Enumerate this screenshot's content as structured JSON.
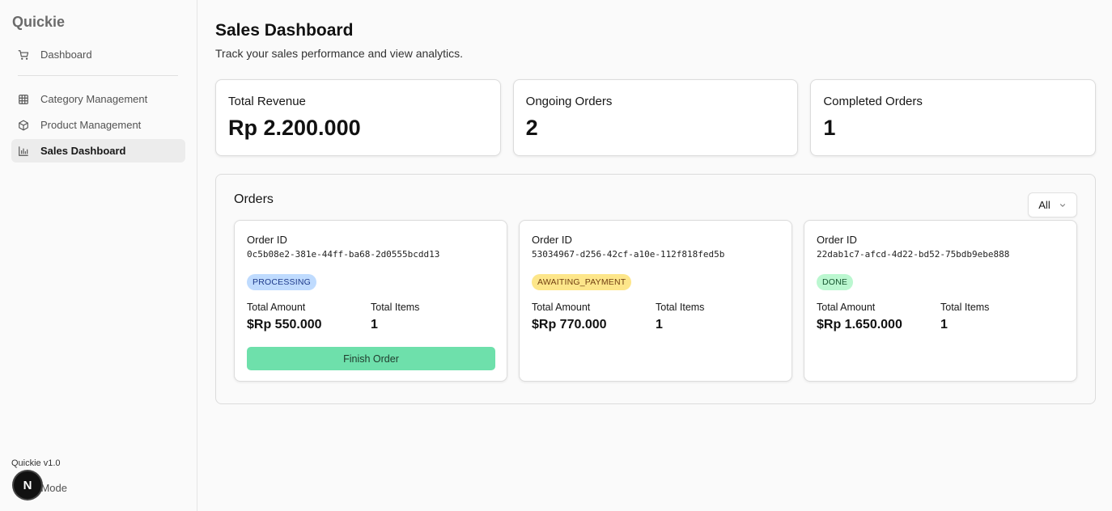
{
  "brand": "Quickie",
  "sidebar": {
    "items": [
      {
        "label": "Dashboard",
        "icon": "cart-icon"
      },
      {
        "label": "Category Management",
        "icon": "grid-icon"
      },
      {
        "label": "Product Management",
        "icon": "box-icon"
      },
      {
        "label": "Sales Dashboard",
        "icon": "bar-chart-icon",
        "active": true
      }
    ],
    "version": "Quickie v1.0",
    "theme_mode": "nt Mode",
    "next_badge": "N"
  },
  "header": {
    "title": "Sales Dashboard",
    "subtitle": "Track your sales performance and view analytics."
  },
  "stats": [
    {
      "label": "Total Revenue",
      "value": "Rp 2.200.000"
    },
    {
      "label": "Ongoing Orders",
      "value": "2"
    },
    {
      "label": "Completed Orders",
      "value": "1"
    }
  ],
  "orders": {
    "title": "Orders",
    "filter_value": "All",
    "labels": {
      "order_id": "Order ID",
      "total_amount": "Total Amount",
      "total_items": "Total Items",
      "finish": "Finish Order"
    },
    "cards": [
      {
        "id": "0c5b08e2-381e-44ff-ba68-2d0555bcdd13",
        "status": "PROCESSING",
        "amount": "$Rp 550.000",
        "items": "1"
      },
      {
        "id": "53034967-d256-42cf-a10e-112f818fed5b",
        "status": "AWAITING_PAYMENT",
        "amount": "$Rp 770.000",
        "items": "1"
      },
      {
        "id": "22dab1c7-afcd-4d22-bd52-75bdb9ebe888",
        "status": "DONE",
        "amount": "$Rp 1.650.000",
        "items": "1"
      }
    ]
  },
  "colors": {
    "processing_bg": "#bfdbfe",
    "processing_fg": "#1e3a8a",
    "awaiting_bg": "#fde68a",
    "awaiting_fg": "#713f12",
    "done_bg": "#bbf7d0",
    "done_fg": "#14532d",
    "finish_button": "#6ee0ab"
  }
}
